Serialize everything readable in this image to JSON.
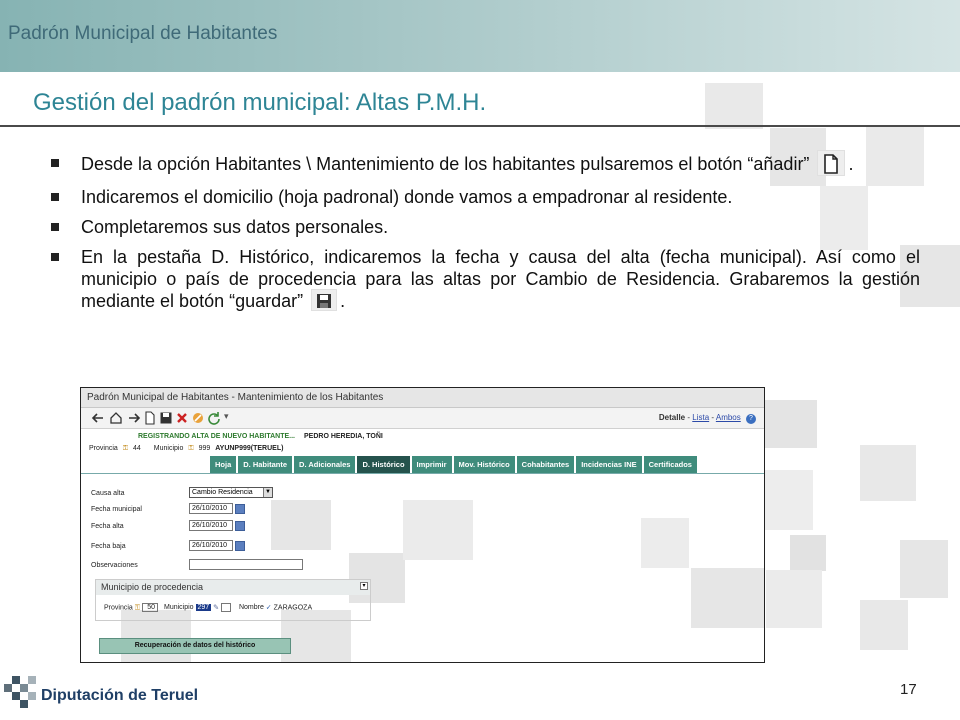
{
  "header": {
    "title": "Padrón Municipal de Habitantes"
  },
  "slide": {
    "title": "Gestión del padrón municipal: Altas P.M.H."
  },
  "bullets": [
    {
      "before": "Desde la opción Habitantes \\ Mantenimiento de los habitantes pulsaremos el botón “añadir”",
      "after": ".",
      "icon": "new-document-icon"
    },
    {
      "before": "Indicaremos el domicilio (hoja padronal) donde vamos a empadronar al residente."
    },
    {
      "before": "Completaremos sus datos personales."
    },
    {
      "before": "En la pestaña D. Histórico, indicaremos la fecha y causa del alta (fecha municipal). Así como el municipio o país de procedencia para las altas por Cambio de Residencia. Grabaremos la gestión mediante el botón “guardar”",
      "after": ".",
      "icon": "floppy-disk-icon"
    }
  ],
  "app": {
    "window_title": "Padrón Municipal de Habitantes - Mantenimiento de los Habitantes",
    "detail": {
      "label": "Detalle",
      "sep": "-",
      "lista": "Lista",
      "sep2": "-",
      "ambos": "Ambos"
    },
    "status": "REGISTRANDO ALTA DE NUEVO HABITANTE...",
    "name": "PEDRO HEREDIA, TOÑI",
    "provincia_label": "Provincia",
    "provincia_value": "44",
    "municipio_label": "Municipio",
    "municipio_value": "999",
    "municipio_name": "AYUNP999(TERUEL)",
    "tabs": [
      "Hoja",
      "D. Habitante",
      "D. Adicionales",
      "D. Histórico",
      "Imprimir",
      "Mov. Histórico",
      "Cohabitantes",
      "Incidencias INE",
      "Certificados"
    ],
    "active_tab": "D. Histórico",
    "form": {
      "causa_alta_label": "Causa alta",
      "causa_alta_value": "Cambio Residencia",
      "fecha_municipal_label": "Fecha municipal",
      "fecha_municipal_value": "26/10/2010",
      "fecha_alta_label": "Fecha alta",
      "fecha_alta_value": "26/10/2010",
      "fecha_baja_label": "Fecha baja",
      "fecha_baja_value": "26/10/2010",
      "observaciones_label": "Observaciones",
      "observaciones_value": ""
    },
    "procedencia": {
      "title": "Municipio de procedencia",
      "provincia_label": "Provincia",
      "provincia_value": "50",
      "municipio_label": "Municipio",
      "municipio_value": "297",
      "nombre_label": "Nombre",
      "nombre_value": "ZARAGOZA"
    },
    "recuperacion_button": "Recuperación de datos del histórico"
  },
  "footer": {
    "brand": "Diputación de Teruel",
    "page_number": "17"
  },
  "colors": {
    "header": "#86b3b3",
    "title": "#2e8595",
    "tab": "#3f8c7c",
    "tab_active": "#25534d"
  }
}
